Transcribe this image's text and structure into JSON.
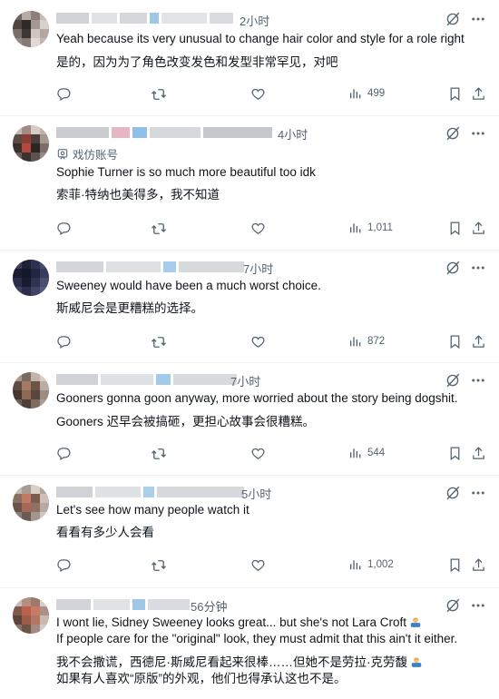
{
  "posts": [
    {
      "time": "2小时",
      "en": "Yeah because its very unusual to change hair color and style for a role right",
      "zh": "是的，因为为了角色改变发色和发型非常罕见，对吧",
      "views": "499"
    },
    {
      "time": "4小时",
      "badge": "戏仿账号",
      "en": "Sophie Turner is so much more beautiful too idk",
      "zh": "索菲·特纳也美得多，我不知道",
      "views": "1,011"
    },
    {
      "time": "7小时",
      "en": "Sweeney would have been a much worst choice.",
      "zh": "斯威尼会是更糟糕的选择。",
      "views": "872"
    },
    {
      "time": "7小时",
      "en": "Gooners gonna goon anyway, more worried about the story being dogshit.",
      "zh": "Gooners 迟早会被搞砸，更担心故事会很糟糕。",
      "views": "544"
    },
    {
      "time": "5小时",
      "en": "Let's see how many people watch it",
      "zh": "看看有多少人会看",
      "views": "1,002"
    },
    {
      "time": "56分钟",
      "en1": "I wont lie, Sidney Sweeney looks great... but she's not Lara Croft",
      "en2": "If people care for the \"original\" look, they must admit that this ain't it either.",
      "zh1": "我不会撒谎，西德尼·斯威尼看起来很棒……但她不是劳拉·克劳馥",
      "zh2": "如果有人喜欢“原版”的外观，他们也得承认这也不是。"
    }
  ],
  "icons": {
    "reply": "reply-icon",
    "repost": "repost-icon",
    "like": "heart-icon",
    "views": "views-icon",
    "bookmark": "bookmark-icon",
    "share": "share-icon",
    "grok": "grok-icon",
    "more": "more-icon"
  },
  "colors": {
    "text": "#0f1419",
    "muted": "#536471",
    "divider": "#eff3f4"
  }
}
